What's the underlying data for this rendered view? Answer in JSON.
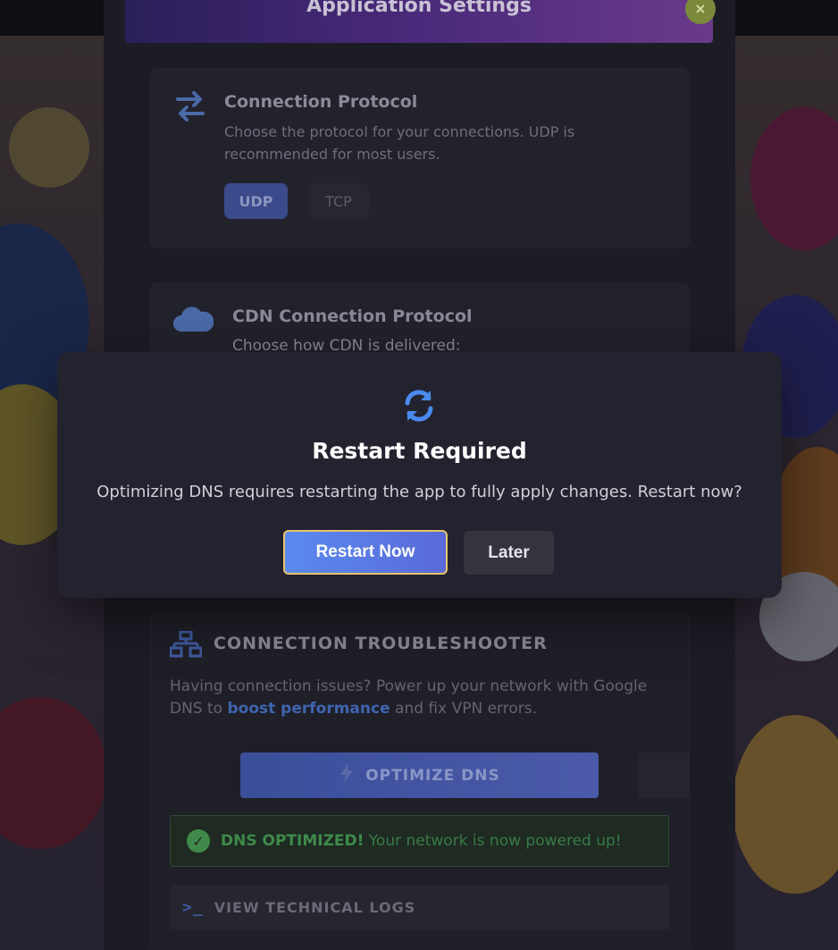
{
  "header": {
    "title": "Application Settings",
    "close_glyph": "×"
  },
  "protocol_card": {
    "icon": "swap-arrows-icon",
    "title": "Connection Protocol",
    "description": "Choose the protocol for your connections. UDP is recommended for most users.",
    "options": [
      "UDP",
      "TCP"
    ],
    "selected": "UDP"
  },
  "cdn_card": {
    "icon": "cloud-icon",
    "title": "CDN Connection Protocol",
    "description": "Choose how CDN is delivered:"
  },
  "troubleshooter": {
    "icon": "network-icon",
    "title": "CONNECTION TROUBLESHOOTER",
    "desc_before": "Having connection issues? Power up your network with Google DNS to ",
    "desc_link": "boost performance",
    "desc_after": " and fix VPN errors.",
    "optimize_label": "OPTIMIZE DNS",
    "success_strong": "DNS OPTIMIZED!",
    "success_text": "Your network is now powered up!",
    "logs_label": "VIEW TECHNICAL LOGS"
  },
  "modal": {
    "icon": "refresh-icon",
    "title": "Restart Required",
    "message": "Optimizing DNS requires restarting the app to fully apply changes. Restart now?",
    "primary_label": "Restart Now",
    "secondary_label": "Later"
  },
  "colors": {
    "accent_blue": "#5a8af0",
    "focus_ring": "#e8c36a",
    "success_green": "#3f8a4a"
  }
}
